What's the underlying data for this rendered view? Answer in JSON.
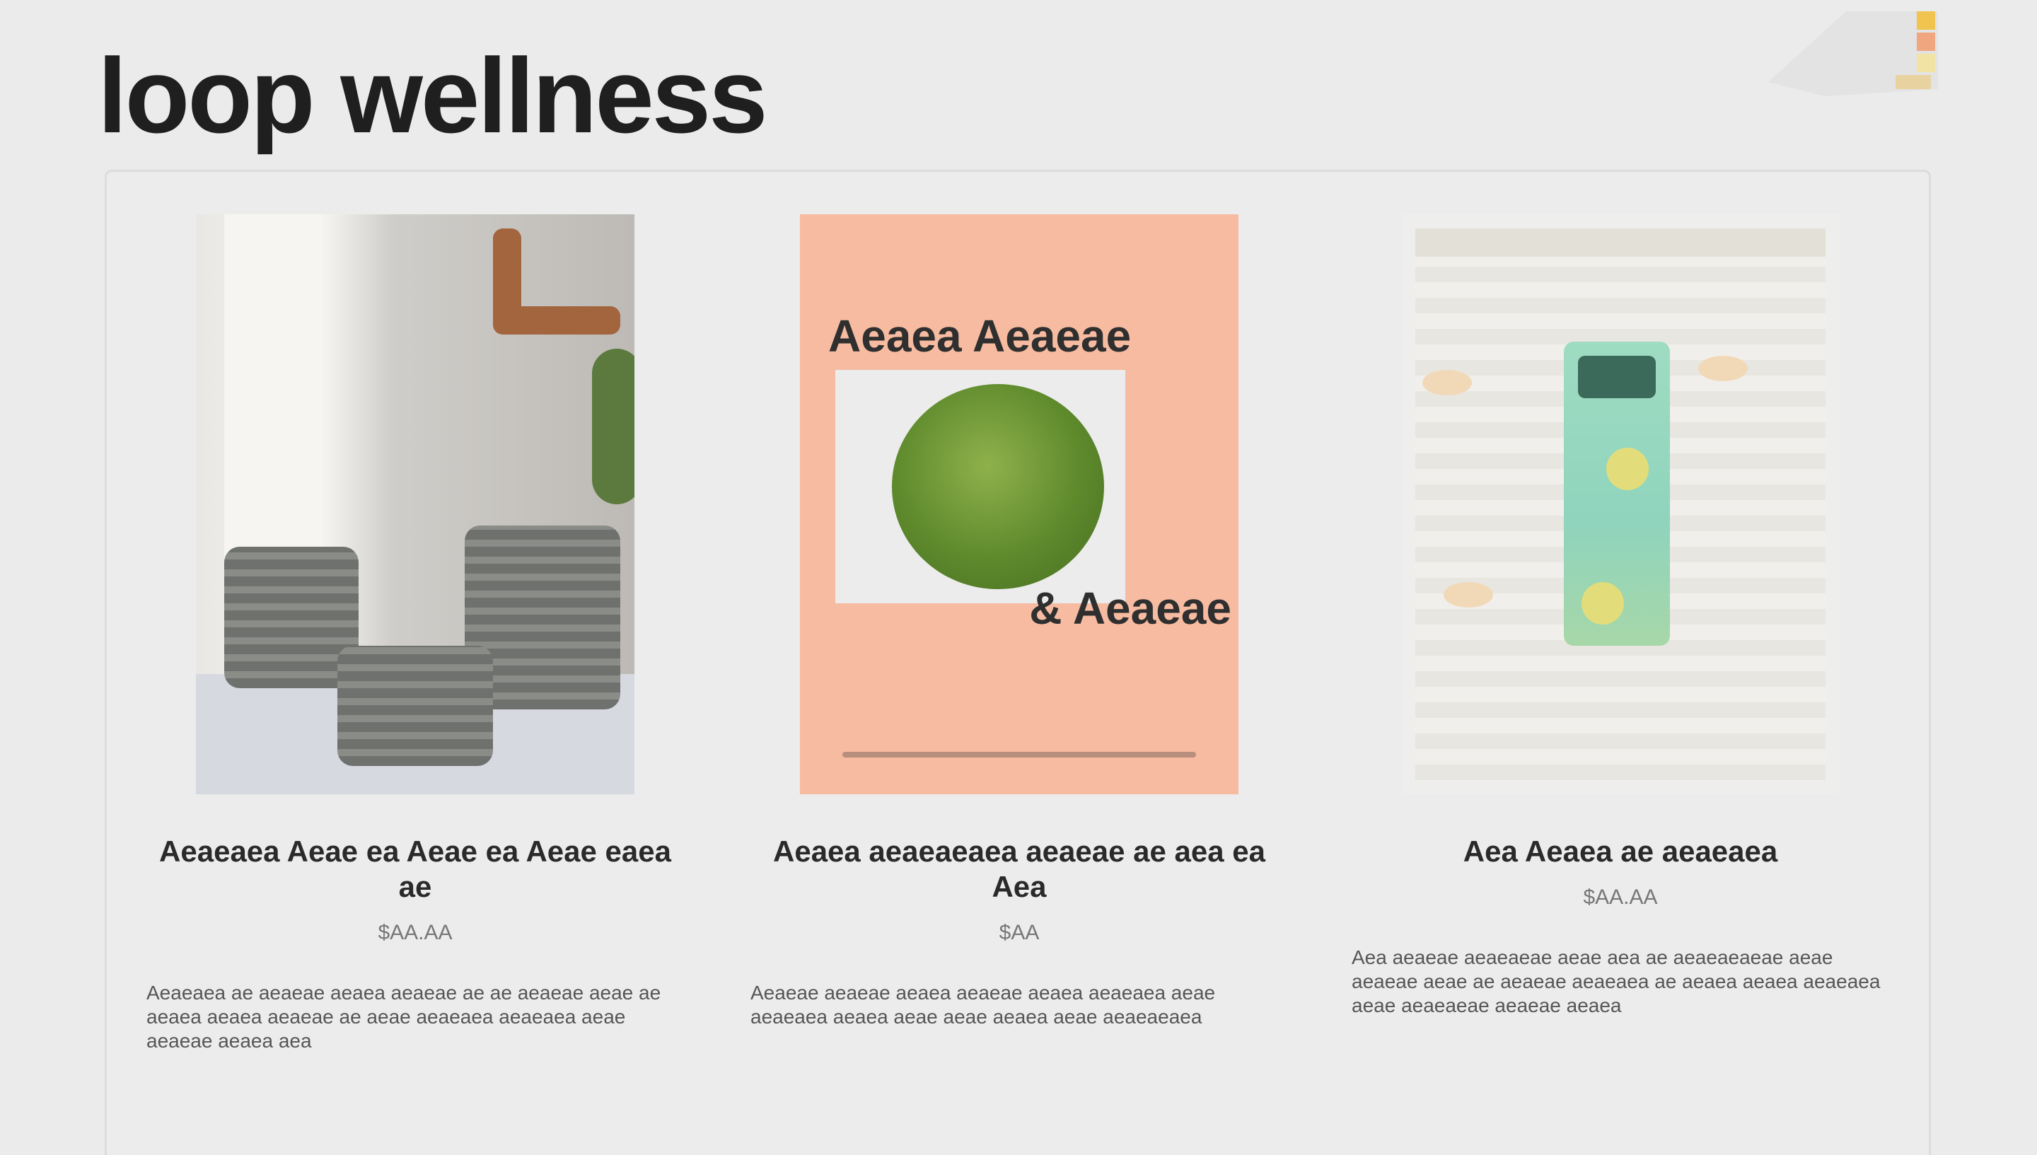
{
  "brand": {
    "title": "loop wellness"
  },
  "products": [
    {
      "name": "Aeaeaea Aeae ea Aeae ea Aeae eaea ae",
      "price": "$AA.AA",
      "description": "Aeaeaea ae aeaeae aeaea aeaeae ae ae aeaeae aeae ae aeaea aeaea aeaeae ae aeae aeaeaea aeaeaea aeae aeaeae aeaea aea"
    },
    {
      "name": "Aeaea aeaeaeaea aeaeae ae aea ea Aea",
      "price": "$AA",
      "description": "Aeaeae aeaeae aeaea aeaeae aeaea aeaeaea aeae aeaeaea aeaea aeae aeae aeaea aeae aeaeaeaea"
    },
    {
      "name": "Aea Aeaea ae aeaeaea",
      "price": "$AA.AA",
      "description": "Aea aeaeae aeaeaeae aeae aea ae aeaeaeaeae aeae aeaeae aeae ae aeaeae aeaeaea ae aeaea aeaea aeaeaea aeae aeaeaeae aeaeae aeaea"
    }
  ],
  "promo_tile": {
    "headline": "Aeaea Aeaeae",
    "subline": "& Aeaeae"
  }
}
